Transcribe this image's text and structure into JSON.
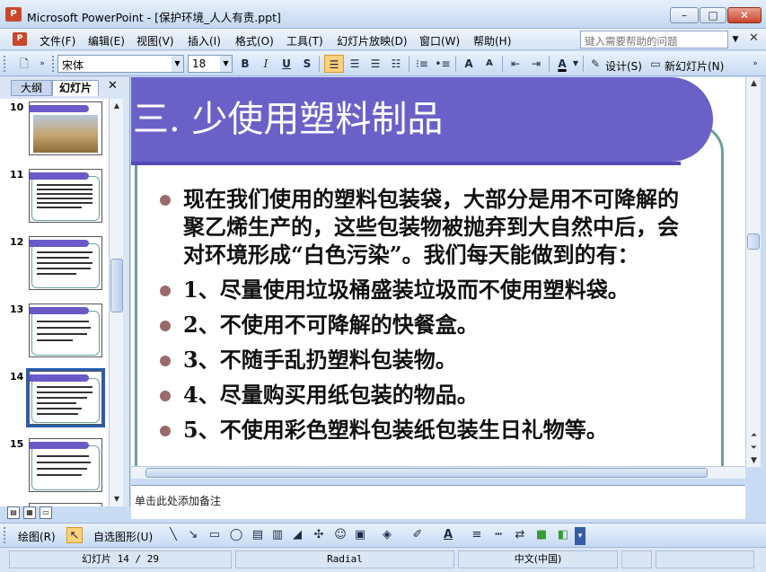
{
  "window": {
    "app_icon": "P",
    "title": "Microsoft PowerPoint - [保护环境_人人有责.ppt]",
    "min_glyph": "–",
    "max_glyph": "□",
    "close_glyph": "✕"
  },
  "menu": {
    "items": [
      "文件(F)",
      "编辑(E)",
      "视图(V)",
      "插入(I)",
      "格式(O)",
      "工具(T)",
      "幻灯片放映(D)",
      "窗口(W)",
      "帮助(H)"
    ],
    "help_placeholder": "键入需要帮助的问题",
    "doc_close": "✕"
  },
  "toolbar": {
    "font_name": "宋体",
    "font_size": "18",
    "bold": "B",
    "italic": "I",
    "underline": "U",
    "shadow": "S",
    "font_grow": "A",
    "font_shrink": "A",
    "font_color": "A",
    "design_label": "设计(S)",
    "new_slide_label": "新幻灯片(N)"
  },
  "left_pane": {
    "tab_outline": "大纲",
    "tab_slides": "幻灯片",
    "close": "✕",
    "slide_numbers": [
      "10",
      "11",
      "12",
      "13",
      "14",
      "15"
    ]
  },
  "slide": {
    "title": "三. 少使用塑料制品",
    "bullets": [
      "现在我们使用的塑料包装袋，大部分是用不可降解的聚乙烯生产的，这些包装物被抛弃到大自然中后，会对环境形成“白色污染”。我们每天能做到的有：",
      "1、尽量使用垃圾桶盛装垃圾而不使用塑料袋。",
      "2、不使用不可降解的快餐盒。",
      "3、不随手乱扔塑料包装物。",
      "4、尽量购买用纸包装的物品。",
      "5、不使用彩色塑料包装纸包装生日礼物等。"
    ]
  },
  "notes": {
    "placeholder": "单击此处添加备注"
  },
  "drawbar": {
    "draw_label": "绘图(R)",
    "autoshape_label": "自选图形(U)"
  },
  "status": {
    "slide_pos": "幻灯片 14 / 29",
    "design": "Radial",
    "language": "中文(中国)"
  },
  "colors": {
    "title_band": "#6a61c8",
    "frame": "#6b9f9a",
    "bullet_dot": "#9a6a6a"
  }
}
